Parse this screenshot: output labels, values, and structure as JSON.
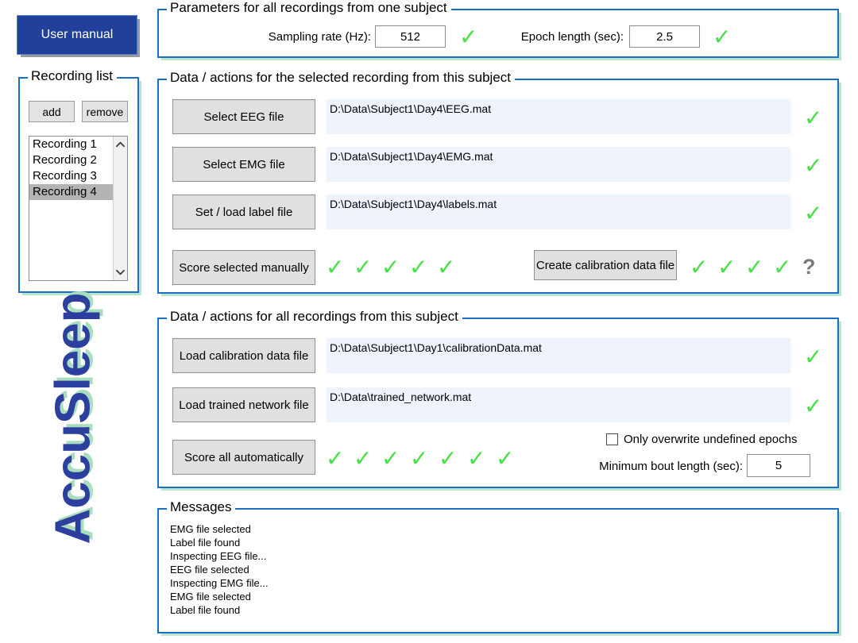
{
  "user_manual": {
    "label": "User manual"
  },
  "logo": {
    "text": "AccuSleep"
  },
  "recording_list": {
    "title": "Recording list",
    "add_label": "add",
    "remove_label": "remove",
    "items": [
      {
        "label": "Recording 1",
        "selected": false
      },
      {
        "label": "Recording 2",
        "selected": false
      },
      {
        "label": "Recording 3",
        "selected": false
      },
      {
        "label": "Recording 4",
        "selected": true
      }
    ],
    "scroll_up_icon": "chevron-up-icon",
    "scroll_down_icon": "chevron-down-icon",
    "scroll_up_glyph": "⌃",
    "scroll_down_glyph": "⌄"
  },
  "parameters": {
    "title": "Parameters for all recordings from one subject",
    "sampling_rate_label": "Sampling rate (Hz):",
    "sampling_rate_value": "512",
    "sampling_rate_status": "✓",
    "epoch_length_label": "Epoch length (sec):",
    "epoch_length_value": "2.5",
    "epoch_length_status": "✓"
  },
  "selected_recording": {
    "title": "Data / actions for the selected recording from this subject",
    "rows": [
      {
        "button": "Select EEG file",
        "path": "D:\\Data\\Subject1\\Day4\\EEG.mat",
        "status": "✓"
      },
      {
        "button": "Select EMG file",
        "path": "D:\\Data\\Subject1\\Day4\\EMG.mat",
        "status": "✓"
      },
      {
        "button": "Set / load label file",
        "path": "D:\\Data\\Subject1\\Day4\\labels.mat",
        "status": "✓"
      }
    ],
    "score_manual_button": "Score selected manually",
    "score_manual_checks": [
      "✓",
      "✓",
      "✓",
      "✓",
      "✓"
    ],
    "create_calibration_button": "Create calibration data file",
    "create_calibration_checks": [
      "✓",
      "✓",
      "✓",
      "✓"
    ],
    "create_calibration_unknown": "?"
  },
  "all_recordings": {
    "title": "Data / actions for all recordings from this subject",
    "rows": [
      {
        "button": "Load calibration data file",
        "path": "D:\\Data\\Subject1\\Day1\\calibrationData.mat",
        "status": "✓"
      },
      {
        "button": "Load trained network file",
        "path": "D:\\Data\\trained_network.mat",
        "status": "✓"
      }
    ],
    "score_auto_button": "Score all automatically",
    "score_auto_checks": [
      "✓",
      "✓",
      "✓",
      "✓",
      "✓",
      "✓",
      "✓"
    ],
    "overwrite_checkbox_label": "Only overwrite undefined epochs",
    "overwrite_checkbox_checked": false,
    "min_bout_label": "Minimum bout length (sec):",
    "min_bout_value": "5"
  },
  "messages": {
    "title": "Messages",
    "lines": [
      "EMG file selected",
      "Label file found",
      "Inspecting EEG file...",
      "EEG file selected",
      "Inspecting EMG file...",
      "EMG file selected",
      "Label file found"
    ]
  },
  "colors": {
    "accent_blue": "#21409a",
    "panel_border": "#1a6fc4",
    "panel_shadow": "#b9e6cd",
    "check_green": "#44e044",
    "unknown_gray": "#7a7a7a",
    "button_gray": "#e0e0e0",
    "path_field_bg": "#eef3fc",
    "list_selection": "#b4b4b4"
  }
}
